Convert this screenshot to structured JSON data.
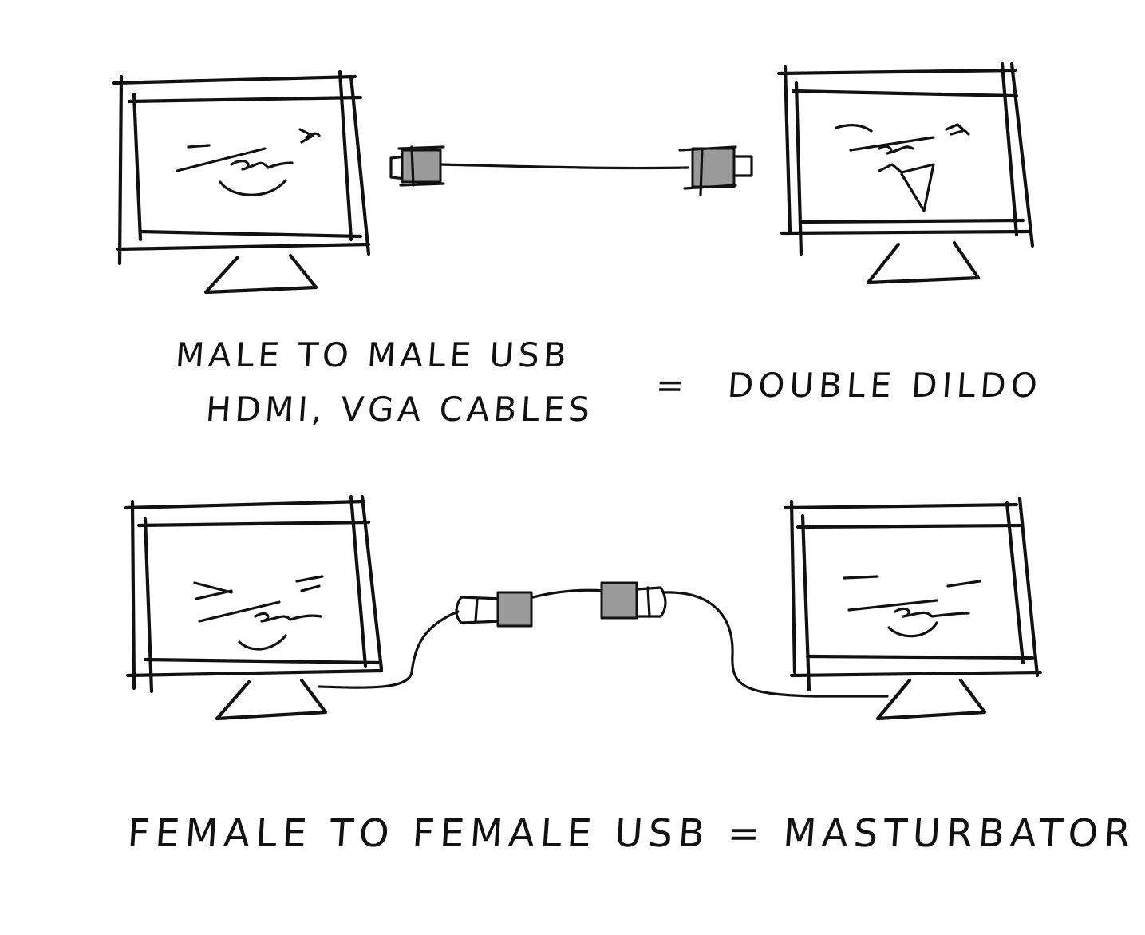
{
  "colors": {
    "background": "#ffffff",
    "ink": "#111111",
    "plug_fill": "#9a9a9a"
  },
  "captions": {
    "male_line_1": "MALE TO MALE USB",
    "male_line_2": "HDMI, VGA CABLES",
    "male_equals": "=",
    "male_result": "DOUBLE DILDO",
    "female_line": "FEMALE TO FEMALE USB = MASTURBATOR"
  }
}
